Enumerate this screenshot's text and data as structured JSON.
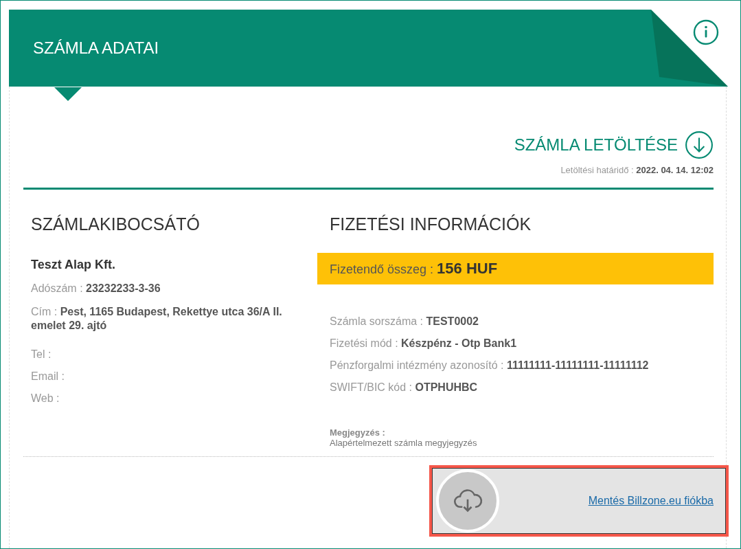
{
  "header": {
    "title": "SZÁMLA ADATAI"
  },
  "download": {
    "label": "SZÁMLA LETÖLTÉSE",
    "deadline_label": "Letöltési határidő :",
    "deadline_value": "2022. 04. 14. 12:02"
  },
  "issuer": {
    "heading": "SZÁMLAKIBOCSÁTÓ",
    "name": "Teszt Alap Kft.",
    "fields": [
      {
        "label": "Adószám :",
        "value": "23232233-3-36"
      },
      {
        "label": "Cím :",
        "value": "Pest, 1165 Budapest, Rekettye utca 36/A II. emelet 29. ajtó"
      }
    ],
    "contacts": [
      {
        "label": "Tel :"
      },
      {
        "label": "Email :"
      },
      {
        "label": "Web :"
      }
    ]
  },
  "payment": {
    "heading": "FIZETÉSI INFORMÁCIÓK",
    "amount_label": "Fizetendő összeg :",
    "amount_value": "156 HUF",
    "fields": [
      {
        "label": "Számla sorszáma :",
        "value": "TEST0002"
      },
      {
        "label": "Fizetési mód :",
        "value": "Készpénz - Otp Bank1"
      },
      {
        "label": "Pénzforgalmi intézmény azonosító :",
        "value": "11111111-11111111-11111112"
      },
      {
        "label": "SWIFT/BIC kód :",
        "value": "OTPHUHBC"
      }
    ],
    "note_label": "Megjegyzés :",
    "note_text": "Alapértelmezett számla megyjegyzés"
  },
  "save": {
    "link": "Mentés Billzone.eu fiókba"
  }
}
